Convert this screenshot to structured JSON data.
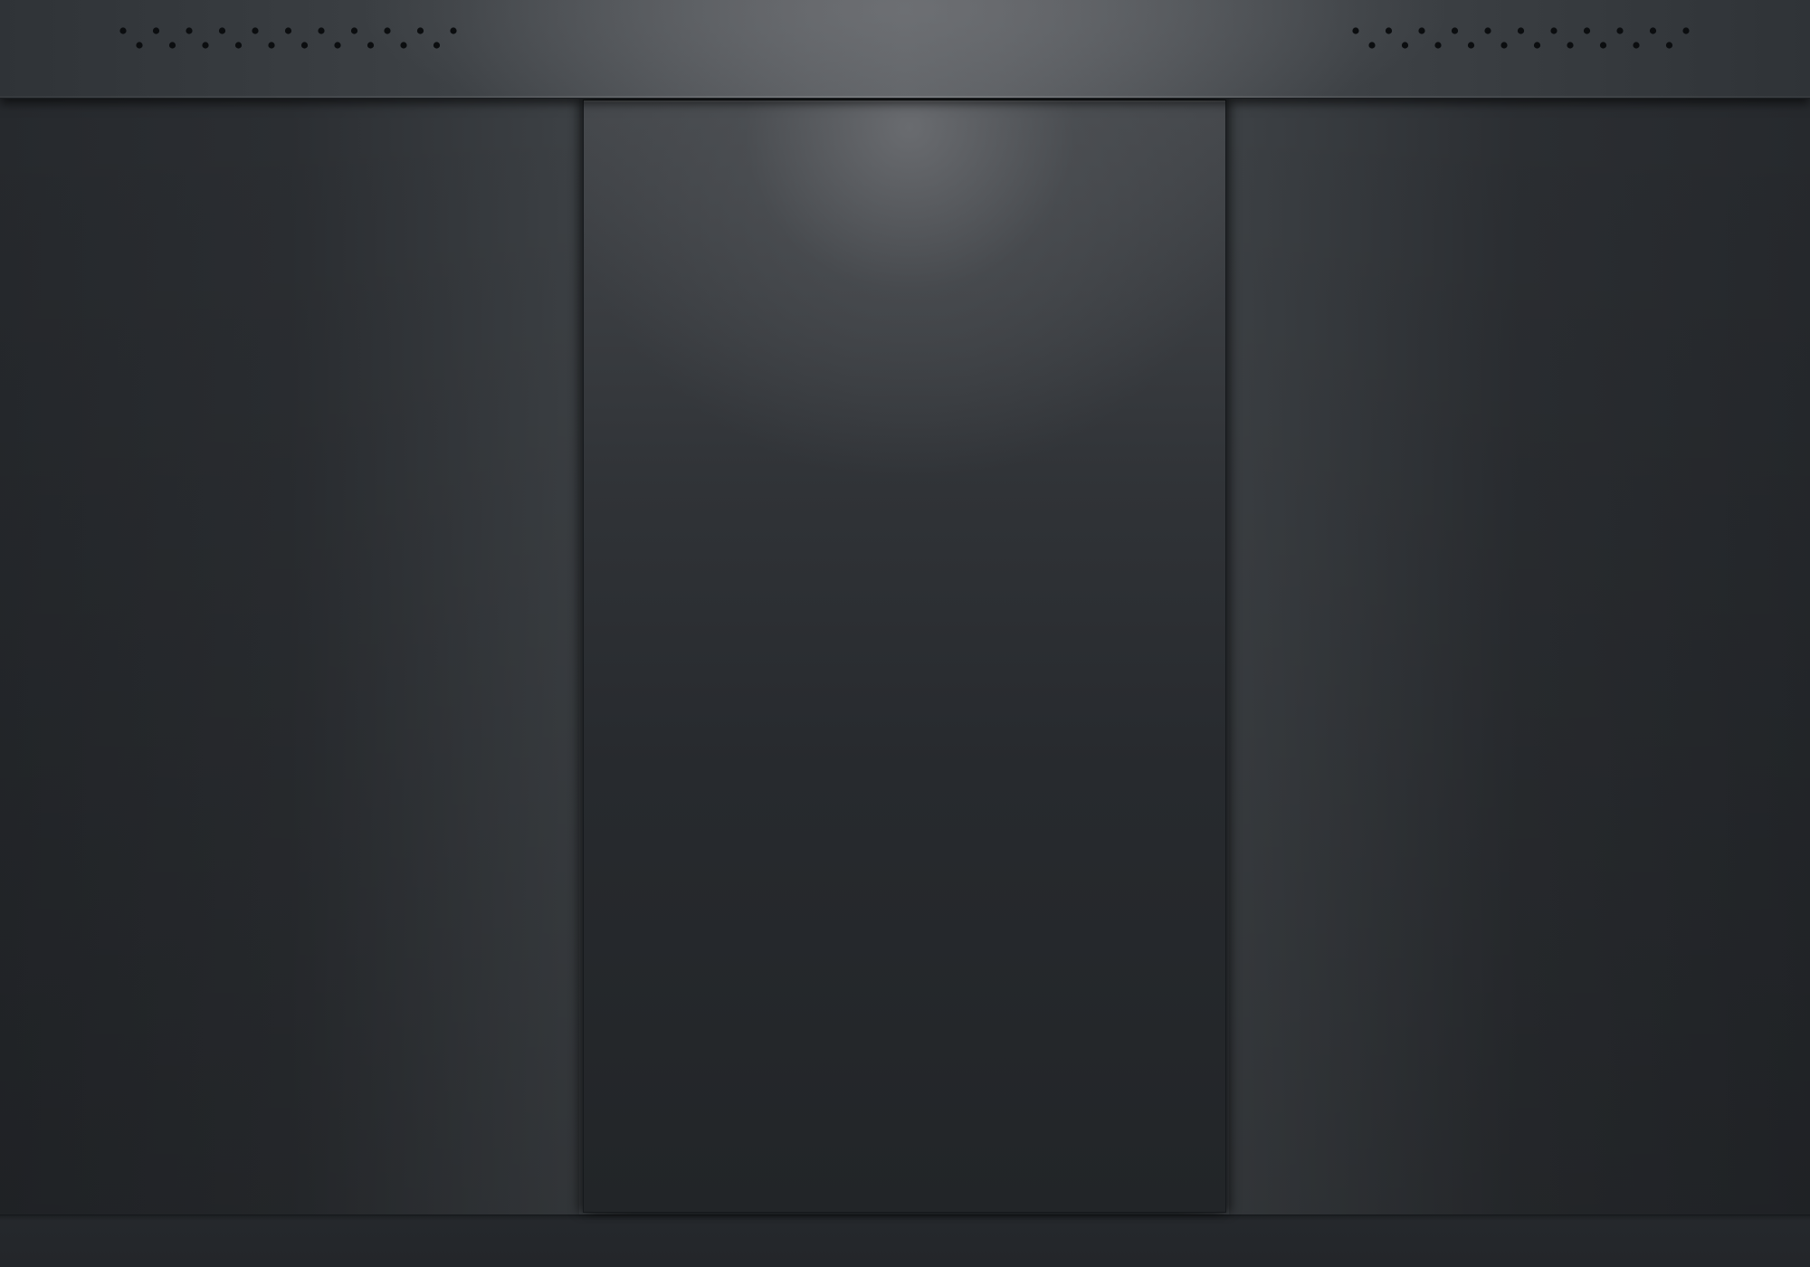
{
  "app": {
    "title": ""
  },
  "panels": {
    "top_bar": {
      "label": ""
    },
    "left_panel": {
      "label": ""
    },
    "center_panel": {
      "label": ""
    },
    "right_panel": {
      "label": ""
    },
    "bottom_strip": {
      "label": ""
    }
  },
  "colors": {
    "background": "#22262a",
    "top_bar_highlight": "#5f6266",
    "panel_dark": "#26292d",
    "center_highlight": "#707276",
    "grille_hole": "#0b0d0f"
  },
  "icons": {
    "left_grille": "speaker-grille-icon",
    "right_grille": "speaker-grille-icon"
  }
}
